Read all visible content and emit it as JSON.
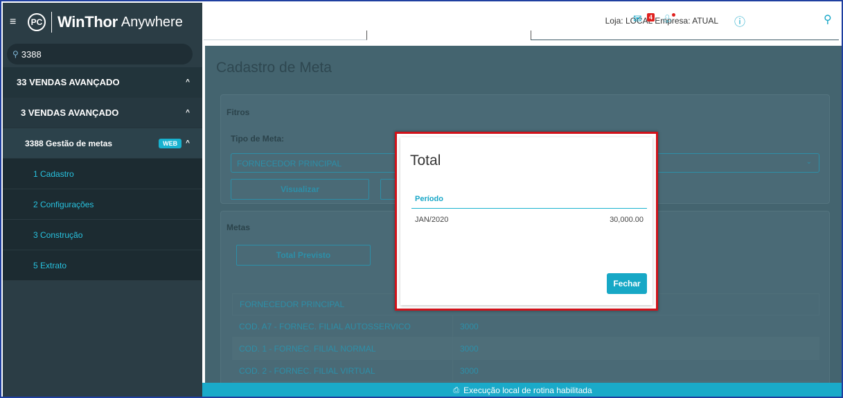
{
  "sidebar": {
    "brand": {
      "logo": "PC",
      "name": "WinThor",
      "name_suffix": "Anywhere"
    },
    "search": {
      "value": "3388"
    },
    "menu": [
      {
        "label": "33  VENDAS AVANÇADO"
      },
      {
        "label": "3  VENDAS AVANÇADO"
      },
      {
        "label": "3388  Gestão de metas",
        "badge": "WEB"
      }
    ],
    "subitems": [
      "1  Cadastro",
      "2  Configurações",
      "3  Construção",
      "5  Extrato"
    ]
  },
  "topbar": {
    "store": "Loja: LOCAL   Empresa: ATUAL",
    "mail_count": "4"
  },
  "page": {
    "title": "Cadastro de Meta",
    "filters_label": "Fitros",
    "type_label": "Tipo de Meta:",
    "type_value": "FORNECEDOR PRINCIPAL",
    "visualize_button": "Visualizar",
    "metas_label": "Metas",
    "total_button": "Total Previsto",
    "table": {
      "header": "FORNECEDOR PRINCIPAL",
      "rows": [
        {
          "name": "COD. A7 - FORNEC. FILIAL AUTOSSERVICO",
          "value": "3000"
        },
        {
          "name": "COD. 1 - FORNEC. FILIAL NORMAL",
          "value": "3000"
        },
        {
          "name": "COD. 2 - FORNEC. FILIAL VIRTUAL",
          "value": "3000"
        }
      ]
    }
  },
  "modal": {
    "title": "Total",
    "column": "Período",
    "row_period": "JAN/2020",
    "row_value": "30,000.00",
    "close_button": "Fechar"
  },
  "statusbar": {
    "text": "Execução local de rotina habilitada"
  },
  "colors": {
    "accent": "#18b2cf",
    "sidebar": "#2b3d45",
    "highlight": "#d0121a"
  }
}
